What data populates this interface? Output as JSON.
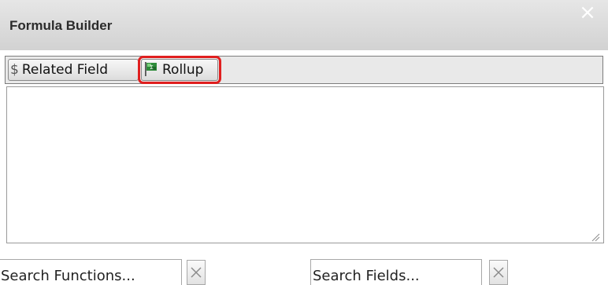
{
  "dialog": {
    "title": "Formula Builder",
    "close_glyph": "×"
  },
  "toolbar": {
    "related_field": {
      "icon": "dollar-icon",
      "icon_glyph": "$",
      "label": "Related Field"
    },
    "rollup": {
      "icon": "rollup-icon",
      "label": "Rollup",
      "highlighted": true,
      "highlight_color": "#e01f1f"
    }
  },
  "editor": {
    "value": ""
  },
  "search": {
    "functions": {
      "placeholder": "Search Functions...",
      "value": ""
    },
    "fields": {
      "placeholder": "Search Fields...",
      "value": ""
    }
  },
  "colors": {
    "titlebar": "#dcdcdc",
    "highlight": "#e01f1f"
  }
}
